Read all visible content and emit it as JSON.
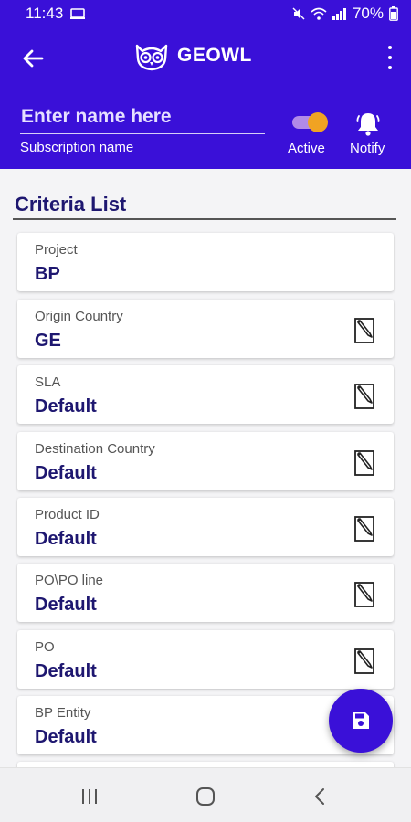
{
  "status": {
    "time": "11:43",
    "battery": "70%"
  },
  "appbar": {
    "brand": "GEOWL",
    "name_placeholder": "Enter name here",
    "name_value": "",
    "subscription_label": "Subscription name",
    "active_label": "Active",
    "notify_label": "Notify",
    "active_on": true
  },
  "criteria": {
    "title": "Criteria List",
    "items": [
      {
        "label": "Project",
        "value": "BP"
      },
      {
        "label": "Origin Country",
        "value": "GE"
      },
      {
        "label": "SLA",
        "value": "Default"
      },
      {
        "label": "Destination Country",
        "value": "Default"
      },
      {
        "label": "Product ID",
        "value": "Default"
      },
      {
        "label": "PO\\PO line",
        "value": "Default"
      },
      {
        "label": "PO",
        "value": "Default"
      },
      {
        "label": "BP Entity",
        "value": "Default"
      }
    ]
  },
  "colors": {
    "primary": "#3a10d8",
    "accent": "#f0a323",
    "value_text": "#1e1770"
  },
  "icons": {
    "back": "arrow-left-icon",
    "menu": "kebab-menu-icon",
    "notify": "bell-icon",
    "edit": "edit-note-icon",
    "save": "floppy-disk-icon",
    "nav": [
      "recent-apps-icon",
      "home-icon",
      "back-chevron-icon"
    ]
  }
}
